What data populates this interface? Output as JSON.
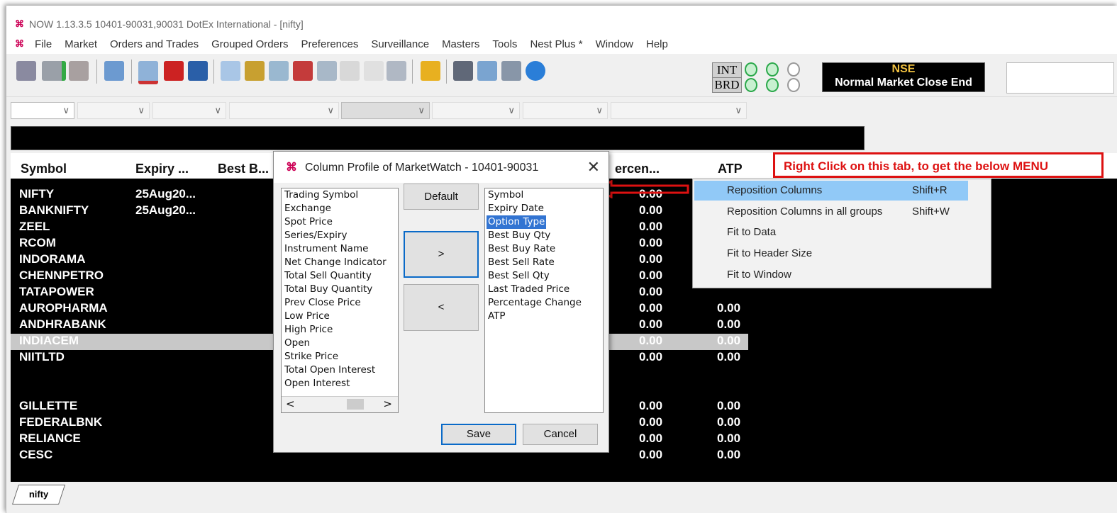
{
  "window": {
    "title": "NOW 1.13.3.5 10401-90031,90031 DotEx International  - [nifty]"
  },
  "menu": [
    "File",
    "Market",
    "Orders and Trades",
    "Grouped Orders",
    "Preferences",
    "Surveillance",
    "Masters",
    "Tools",
    "Nest Plus *",
    "Window",
    "Help"
  ],
  "status": {
    "int_label": "INT",
    "brd_label": "BRD",
    "exchange": "NSE",
    "market_status": "Normal Market Close End"
  },
  "grid": {
    "headers": [
      "Symbol",
      "Expiry ...",
      "Best B...",
      "ercen...",
      "ATP"
    ],
    "rows": [
      {
        "symbol": "NIFTY",
        "expiry": "25Aug20...",
        "pct": "0.00",
        "atp": ""
      },
      {
        "symbol": "BANKNIFTY",
        "expiry": "25Aug20...",
        "pct": "0.00",
        "atp": ""
      },
      {
        "symbol": "ZEEL",
        "expiry": "",
        "pct": "0.00",
        "atp": ""
      },
      {
        "symbol": "RCOM",
        "expiry": "",
        "pct": "0.00",
        "atp": ""
      },
      {
        "symbol": "INDORAMA",
        "expiry": "",
        "pct": "0.00",
        "atp": ""
      },
      {
        "symbol": "CHENNPETRO",
        "expiry": "",
        "pct": "0.00",
        "atp": ""
      },
      {
        "symbol": "TATAPOWER",
        "expiry": "",
        "pct": "0.00",
        "atp": ""
      },
      {
        "symbol": "AUROPHARMA",
        "expiry": "",
        "pct": "0.00",
        "atp": "0.00"
      },
      {
        "symbol": "ANDHRABANK",
        "expiry": "",
        "pct": "0.00",
        "atp": "0.00"
      },
      {
        "symbol": "INDIACEM",
        "expiry": "",
        "pct": "0.00",
        "atp": "0.00"
      },
      {
        "symbol": "NIITLTD",
        "expiry": "",
        "pct": "0.00",
        "atp": "0.00"
      },
      {
        "symbol": "GILLETTE",
        "expiry": "",
        "pct": "0.00",
        "atp": "0.00"
      },
      {
        "symbol": "FEDERALBNK",
        "expiry": "",
        "pct": "0.00",
        "atp": "0.00"
      },
      {
        "symbol": "RELIANCE",
        "expiry": "",
        "pct": "0.00",
        "atp": "0.00"
      },
      {
        "symbol": "CESC",
        "expiry": "",
        "pct": "0.00",
        "atp": "0.00"
      }
    ]
  },
  "tab": {
    "label": "nifty"
  },
  "dialog": {
    "title": "Column Profile of MarketWatch - 10401-90031",
    "available": [
      "Trading Symbol",
      "Exchange",
      "Spot Price",
      "Series/Expiry",
      "Instrument Name",
      "Net Change Indicator",
      "Total Sell Quantity",
      "Total Buy Quantity",
      "Prev Close Price",
      "Low Price",
      "High Price",
      "Open",
      "Strike Price",
      "Total Open Interest",
      "Open Interest"
    ],
    "selected": [
      "Symbol",
      "Expiry Date",
      "Option Type",
      "Best Buy Qty",
      "Best Buy Rate",
      "Best Sell Rate",
      "Best Sell Qty",
      "Last Traded Price",
      "Percentage Change",
      "ATP"
    ],
    "highlighted": "Option Type",
    "default_label": "Default",
    "add_label": ">",
    "remove_label": "<",
    "save_label": "Save",
    "cancel_label": "Cancel",
    "scroll_left": "<",
    "scroll_right": ">"
  },
  "context_menu": [
    {
      "label": "Reposition Columns",
      "shortcut": "Shift+R"
    },
    {
      "label": "Reposition Columns in all groups",
      "shortcut": "Shift+W"
    },
    {
      "label": "Fit to Data",
      "shortcut": ""
    },
    {
      "label": "Fit to Header Size",
      "shortcut": ""
    },
    {
      "label": "Fit to Window",
      "shortcut": ""
    }
  ],
  "annotation": {
    "text": "Right Click on this tab, to get the below MENU"
  },
  "colors": {
    "accent_red": "#d11111",
    "highlight": "#3274d2",
    "menu_hover": "#91c9f7"
  }
}
